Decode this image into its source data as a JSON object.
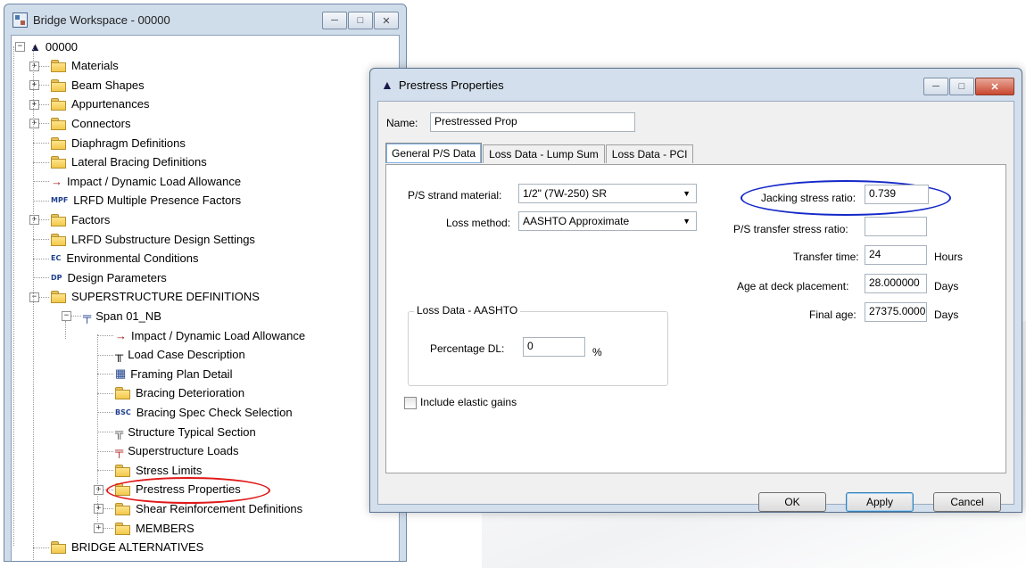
{
  "workspace": {
    "title": "Bridge Workspace - 00000",
    "buttons": {
      "minimize": "─",
      "maximize": "□",
      "close": "✕"
    },
    "tree": [
      {
        "label": "00000",
        "icon": "bridge-icon",
        "level": 0,
        "expander": "−"
      },
      {
        "label": "Materials",
        "icon": "folder-icon",
        "level": 1,
        "expander": "+"
      },
      {
        "label": "Beam Shapes",
        "icon": "folder-icon",
        "level": 1,
        "expander": "+"
      },
      {
        "label": "Appurtenances",
        "icon": "folder-icon",
        "level": 1,
        "expander": "+"
      },
      {
        "label": "Connectors",
        "icon": "folder-icon",
        "level": 1,
        "expander": "+"
      },
      {
        "label": "Diaphragm Definitions",
        "icon": "folder-icon",
        "level": 1,
        "expander": ""
      },
      {
        "label": "Lateral Bracing Definitions",
        "icon": "folder-icon",
        "level": 1,
        "expander": ""
      },
      {
        "label": "Impact / Dynamic Load Allowance",
        "icon": "impact-arrow-icon",
        "level": 1,
        "expander": ""
      },
      {
        "label": "LRFD Multiple Presence Factors",
        "icon": "mpf-icon",
        "icon_text": "MPF",
        "level": 1,
        "expander": ""
      },
      {
        "label": "Factors",
        "icon": "folder-icon",
        "level": 1,
        "expander": "+"
      },
      {
        "label": "LRFD Substructure Design Settings",
        "icon": "folder-icon",
        "level": 1,
        "expander": ""
      },
      {
        "label": "Environmental Conditions",
        "icon": "ec-icon",
        "icon_text": "EC",
        "level": 1,
        "expander": ""
      },
      {
        "label": "Design Parameters",
        "icon": "dp-icon",
        "icon_text": "DP",
        "level": 1,
        "expander": ""
      },
      {
        "label": "SUPERSTRUCTURE DEFINITIONS",
        "icon": "folder-icon",
        "level": 1,
        "expander": "−"
      },
      {
        "label": "Span 01_NB",
        "icon": "span-icon",
        "level": 2,
        "expander": "−"
      },
      {
        "label": "Impact / Dynamic Load Allowance",
        "icon": "impact-arrow-icon",
        "level": 3,
        "expander": ""
      },
      {
        "label": "Load Case Description",
        "icon": "load-case-icon",
        "level": 3,
        "expander": ""
      },
      {
        "label": "Framing Plan Detail",
        "icon": "framing-plan-icon",
        "level": 3,
        "expander": ""
      },
      {
        "label": "Bracing Deterioration",
        "icon": "folder-icon",
        "level": 3,
        "expander": ""
      },
      {
        "label": "Bracing Spec Check Selection",
        "icon": "bsc-icon",
        "icon_text": "BSC",
        "level": 3,
        "expander": ""
      },
      {
        "label": "Structure Typical Section",
        "icon": "typical-section-icon",
        "level": 3,
        "expander": ""
      },
      {
        "label": "Superstructure Loads",
        "icon": "superstructure-loads-icon",
        "level": 3,
        "expander": ""
      },
      {
        "label": "Stress Limits",
        "icon": "folder-icon",
        "level": 3,
        "expander": ""
      },
      {
        "label": "Prestress Properties",
        "icon": "folder-icon",
        "level": 3,
        "expander": "+",
        "highlighted": true
      },
      {
        "label": "Shear Reinforcement Definitions",
        "icon": "folder-icon",
        "level": 3,
        "expander": "+"
      },
      {
        "label": "MEMBERS",
        "icon": "folder-icon",
        "level": 3,
        "expander": "+"
      },
      {
        "label": "BRIDGE ALTERNATIVES",
        "icon": "folder-icon",
        "level": 1,
        "expander": ""
      }
    ]
  },
  "dialog": {
    "title": "Prestress Properties",
    "name_label": "Name:",
    "name_value": "Prestressed Prop",
    "tabs": [
      "General P/S Data",
      "Loss Data - Lump Sum",
      "Loss Data - PCI"
    ],
    "active_tab": 0,
    "ps_strand_material_label": "P/S strand material:",
    "ps_strand_material_value": "1/2\" (7W-250) SR",
    "loss_method_label": "Loss method:",
    "loss_method_value": "AASHTO Approximate",
    "jacking_stress_ratio_label": "Jacking stress ratio:",
    "jacking_stress_ratio_value": "0.739",
    "ps_transfer_stress_ratio_label": "P/S transfer stress ratio:",
    "ps_transfer_stress_ratio_value": "",
    "transfer_time_label": "Transfer time:",
    "transfer_time_value": "24",
    "transfer_time_unit": "Hours",
    "age_at_deck_placement_label": "Age at deck placement:",
    "age_at_deck_placement_value": "28.000000",
    "age_at_deck_placement_unit": "Days",
    "final_age_label": "Final age:",
    "final_age_value": "27375.0000",
    "final_age_unit": "Days",
    "loss_data_group_label": "Loss Data - AASHTO",
    "percentage_dl_label": "Percentage DL:",
    "percentage_dl_value": "0",
    "percentage_dl_unit": "%",
    "include_elastic_gains_label": "Include elastic gains",
    "include_elastic_gains_checked": false,
    "buttons": {
      "ok": "OK",
      "apply": "Apply",
      "cancel": "Cancel"
    }
  },
  "colors": {
    "highlight_red": "#e01818",
    "highlight_blue": "#1428c8"
  }
}
